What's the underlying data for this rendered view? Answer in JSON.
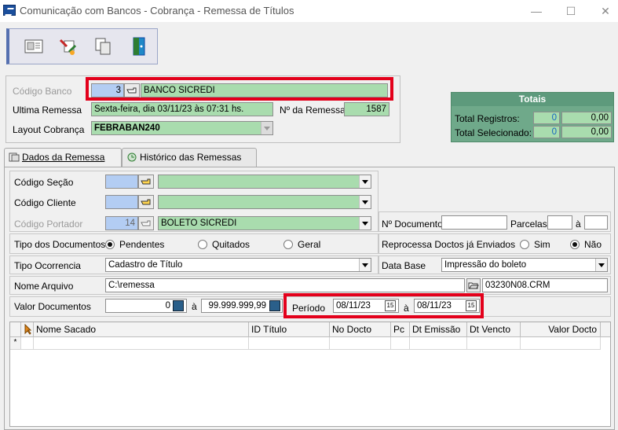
{
  "window": {
    "title": "Comunicação com Bancos - Cobrança - Remessa de Títulos",
    "minimize": "—",
    "maximize": "☐",
    "close": "✕"
  },
  "toolbar": {
    "buttons": [
      "print-preview-icon",
      "edit-tools-icon",
      "copy-icon",
      "exit-door-icon"
    ]
  },
  "header": {
    "codigo_banco_label": "Código Banco",
    "codigo_banco_value": "3",
    "banco_nome": "BANCO SICREDI",
    "ultima_remessa_label": "Ultima Remessa",
    "ultima_remessa_value": "Sexta-feira, dia 03/11/23 às 07:31 hs.",
    "nr_remessa_label": "Nº da Remessa",
    "nr_remessa_value": "1587",
    "layout_label": "Layout Cobrança",
    "layout_value": "FEBRABAN240"
  },
  "totais": {
    "title": "Totais",
    "total_registros_label": "Total Registros:",
    "total_registros_count": "0",
    "total_registros_value": "0,00",
    "total_selecionado_label": "Total Selecionado:",
    "total_selecionado_count": "0",
    "total_selecionado_value": "0,00"
  },
  "tabs": [
    {
      "label": "Dados da Remessa"
    },
    {
      "label": "Histórico das Remessas"
    }
  ],
  "form": {
    "codigo_secao_label": "Código Seção",
    "codigo_secao_value": "",
    "codigo_cliente_label": "Código Cliente",
    "codigo_cliente_value": "",
    "codigo_portador_label": "Código Portador",
    "codigo_portador_value": "14",
    "portador_nome": "BOLETO SICREDI",
    "nr_documento_label": "Nº Documento",
    "nr_documento_value": "",
    "parcelas_label": "Parcelas",
    "parcelas_a": "à",
    "tipo_documentos_label": "Tipo dos Documentos",
    "tipo_options": [
      "Pendentes",
      "Quitados",
      "Geral"
    ],
    "tipo_selected": "Pendentes",
    "reprocessa_label": "Reprocessa Doctos já Enviados",
    "reprocessa_options": [
      "Sim",
      "Não"
    ],
    "reprocessa_selected": "Não",
    "tipo_ocorrencia_label": "Tipo Ocorrencia",
    "tipo_ocorrencia_value": "Cadastro de Título",
    "data_base_label": "Data Base",
    "data_base_value": "Impressão do boleto",
    "nome_arquivo_label": "Nome Arquivo",
    "nome_arquivo_value": "C:\\remessa",
    "arquivo_gerado": "03230N08.CRM",
    "valor_documentos_label": "Valor Documentos",
    "valor_de": "0",
    "valor_a": "à",
    "valor_ate": "99.999.999,99",
    "periodo_label": "Período",
    "periodo_de": "08/11/23",
    "periodo_a": "à",
    "periodo_ate": "08/11/23"
  },
  "grid": {
    "columns": [
      "Nome Sacado",
      "ID Título",
      "No Docto",
      "Pc",
      "Dt Emissão",
      "Dt Vencto",
      "Valor Docto"
    ],
    "new_row_marker": "*"
  },
  "colors": {
    "highlight": "#e3001b",
    "field_green": "#a9dcae",
    "field_blue": "#b3cdf3",
    "totais_bg": "#6fa98a"
  }
}
